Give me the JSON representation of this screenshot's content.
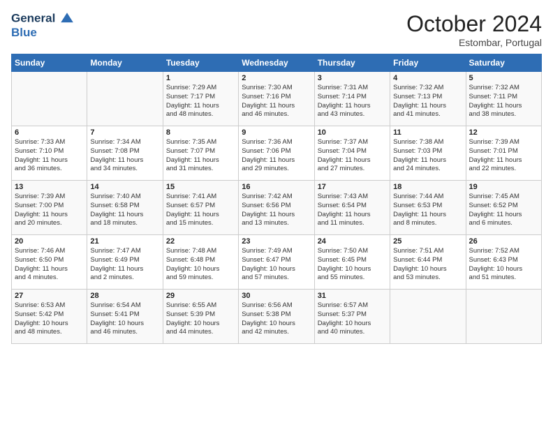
{
  "logo": {
    "line1": "General",
    "line2": "Blue"
  },
  "title": "October 2024",
  "location": "Estombar, Portugal",
  "header_days": [
    "Sunday",
    "Monday",
    "Tuesday",
    "Wednesday",
    "Thursday",
    "Friday",
    "Saturday"
  ],
  "weeks": [
    [
      {
        "day": "",
        "info": ""
      },
      {
        "day": "",
        "info": ""
      },
      {
        "day": "1",
        "info": "Sunrise: 7:29 AM\nSunset: 7:17 PM\nDaylight: 11 hours\nand 48 minutes."
      },
      {
        "day": "2",
        "info": "Sunrise: 7:30 AM\nSunset: 7:16 PM\nDaylight: 11 hours\nand 46 minutes."
      },
      {
        "day": "3",
        "info": "Sunrise: 7:31 AM\nSunset: 7:14 PM\nDaylight: 11 hours\nand 43 minutes."
      },
      {
        "day": "4",
        "info": "Sunrise: 7:32 AM\nSunset: 7:13 PM\nDaylight: 11 hours\nand 41 minutes."
      },
      {
        "day": "5",
        "info": "Sunrise: 7:32 AM\nSunset: 7:11 PM\nDaylight: 11 hours\nand 38 minutes."
      }
    ],
    [
      {
        "day": "6",
        "info": "Sunrise: 7:33 AM\nSunset: 7:10 PM\nDaylight: 11 hours\nand 36 minutes."
      },
      {
        "day": "7",
        "info": "Sunrise: 7:34 AM\nSunset: 7:08 PM\nDaylight: 11 hours\nand 34 minutes."
      },
      {
        "day": "8",
        "info": "Sunrise: 7:35 AM\nSunset: 7:07 PM\nDaylight: 11 hours\nand 31 minutes."
      },
      {
        "day": "9",
        "info": "Sunrise: 7:36 AM\nSunset: 7:06 PM\nDaylight: 11 hours\nand 29 minutes."
      },
      {
        "day": "10",
        "info": "Sunrise: 7:37 AM\nSunset: 7:04 PM\nDaylight: 11 hours\nand 27 minutes."
      },
      {
        "day": "11",
        "info": "Sunrise: 7:38 AM\nSunset: 7:03 PM\nDaylight: 11 hours\nand 24 minutes."
      },
      {
        "day": "12",
        "info": "Sunrise: 7:39 AM\nSunset: 7:01 PM\nDaylight: 11 hours\nand 22 minutes."
      }
    ],
    [
      {
        "day": "13",
        "info": "Sunrise: 7:39 AM\nSunset: 7:00 PM\nDaylight: 11 hours\nand 20 minutes."
      },
      {
        "day": "14",
        "info": "Sunrise: 7:40 AM\nSunset: 6:58 PM\nDaylight: 11 hours\nand 18 minutes."
      },
      {
        "day": "15",
        "info": "Sunrise: 7:41 AM\nSunset: 6:57 PM\nDaylight: 11 hours\nand 15 minutes."
      },
      {
        "day": "16",
        "info": "Sunrise: 7:42 AM\nSunset: 6:56 PM\nDaylight: 11 hours\nand 13 minutes."
      },
      {
        "day": "17",
        "info": "Sunrise: 7:43 AM\nSunset: 6:54 PM\nDaylight: 11 hours\nand 11 minutes."
      },
      {
        "day": "18",
        "info": "Sunrise: 7:44 AM\nSunset: 6:53 PM\nDaylight: 11 hours\nand 8 minutes."
      },
      {
        "day": "19",
        "info": "Sunrise: 7:45 AM\nSunset: 6:52 PM\nDaylight: 11 hours\nand 6 minutes."
      }
    ],
    [
      {
        "day": "20",
        "info": "Sunrise: 7:46 AM\nSunset: 6:50 PM\nDaylight: 11 hours\nand 4 minutes."
      },
      {
        "day": "21",
        "info": "Sunrise: 7:47 AM\nSunset: 6:49 PM\nDaylight: 11 hours\nand 2 minutes."
      },
      {
        "day": "22",
        "info": "Sunrise: 7:48 AM\nSunset: 6:48 PM\nDaylight: 10 hours\nand 59 minutes."
      },
      {
        "day": "23",
        "info": "Sunrise: 7:49 AM\nSunset: 6:47 PM\nDaylight: 10 hours\nand 57 minutes."
      },
      {
        "day": "24",
        "info": "Sunrise: 7:50 AM\nSunset: 6:45 PM\nDaylight: 10 hours\nand 55 minutes."
      },
      {
        "day": "25",
        "info": "Sunrise: 7:51 AM\nSunset: 6:44 PM\nDaylight: 10 hours\nand 53 minutes."
      },
      {
        "day": "26",
        "info": "Sunrise: 7:52 AM\nSunset: 6:43 PM\nDaylight: 10 hours\nand 51 minutes."
      }
    ],
    [
      {
        "day": "27",
        "info": "Sunrise: 6:53 AM\nSunset: 5:42 PM\nDaylight: 10 hours\nand 48 minutes."
      },
      {
        "day": "28",
        "info": "Sunrise: 6:54 AM\nSunset: 5:41 PM\nDaylight: 10 hours\nand 46 minutes."
      },
      {
        "day": "29",
        "info": "Sunrise: 6:55 AM\nSunset: 5:39 PM\nDaylight: 10 hours\nand 44 minutes."
      },
      {
        "day": "30",
        "info": "Sunrise: 6:56 AM\nSunset: 5:38 PM\nDaylight: 10 hours\nand 42 minutes."
      },
      {
        "day": "31",
        "info": "Sunrise: 6:57 AM\nSunset: 5:37 PM\nDaylight: 10 hours\nand 40 minutes."
      },
      {
        "day": "",
        "info": ""
      },
      {
        "day": "",
        "info": ""
      }
    ]
  ]
}
